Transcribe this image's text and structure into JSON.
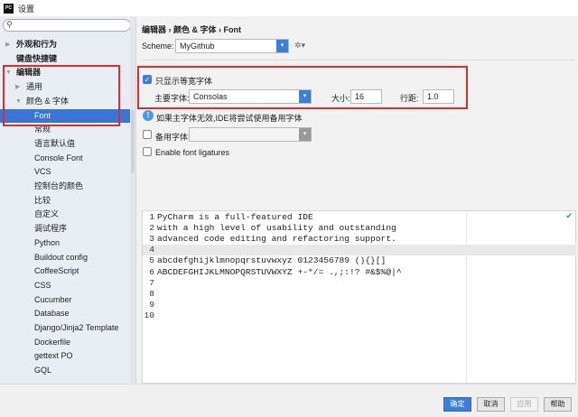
{
  "window": {
    "title": "设置"
  },
  "sidebar": {
    "search_placeholder": "",
    "items": [
      {
        "label": "外观和行为"
      },
      {
        "label": "键盘快捷键"
      },
      {
        "label": "编辑器"
      },
      {
        "label": "通用"
      },
      {
        "label": "颜色 & 字体"
      },
      {
        "label": "Font"
      },
      {
        "label": "常规"
      },
      {
        "label": "语言默认值"
      },
      {
        "label": "Console Font"
      },
      {
        "label": "VCS"
      },
      {
        "label": "控制台的颜色"
      },
      {
        "label": "比较"
      },
      {
        "label": "自定义"
      },
      {
        "label": "调试程序"
      },
      {
        "label": "Python"
      },
      {
        "label": "Buildout config"
      },
      {
        "label": "CoffeeScript"
      },
      {
        "label": "CSS"
      },
      {
        "label": "Cucumber"
      },
      {
        "label": "Database"
      },
      {
        "label": "Django/Jinja2 Template"
      },
      {
        "label": "Dockerfile"
      },
      {
        "label": "gettext PO"
      },
      {
        "label": "GQL"
      }
    ]
  },
  "main": {
    "breadcrumb": "编辑器 › 颜色 & 字体 › Font",
    "scheme_label": "Scheme:",
    "scheme_value": "MyGithub",
    "mono_only_label": "只显示等宽字体",
    "mono_only_checked": true,
    "primary_font_label": "主要字体:",
    "primary_font_value": "Consolas",
    "size_label": "大小:",
    "size_value": "16",
    "line_spacing_label": "行距:",
    "line_spacing_value": "1.0",
    "info_text": "如果主字体无效,IDE将尝试使用备用字体",
    "fallback_label": "备用字体:",
    "fallback_checked": false,
    "ligatures_label": "Enable font ligatures",
    "ligatures_checked": false,
    "preview_lines": [
      {
        "n": "1",
        "text": "PyCharm is a full-featured IDE"
      },
      {
        "n": "2",
        "text": "with a high level of usability and outstanding"
      },
      {
        "n": "3",
        "text": "advanced code editing and refactoring support."
      },
      {
        "n": "4",
        "text": ""
      },
      {
        "n": "5",
        "text": "abcdefghijklmnopqrstuvwxyz 0123456789 (){}[]"
      },
      {
        "n": "6",
        "text": "ABCDEFGHIJKLMNOPQRSTUVWXYZ +-*/= .,;:!? #&$%@|^"
      },
      {
        "n": "7",
        "text": ""
      },
      {
        "n": "8",
        "text": ""
      },
      {
        "n": "9",
        "text": ""
      },
      {
        "n": "10",
        "text": ""
      }
    ]
  },
  "buttons": {
    "ok": "确定",
    "cancel": "取消",
    "apply": "应用",
    "help": "帮助"
  },
  "colors": {
    "accent": "#3c7fd8",
    "highlight_box": "#e02b2b"
  }
}
